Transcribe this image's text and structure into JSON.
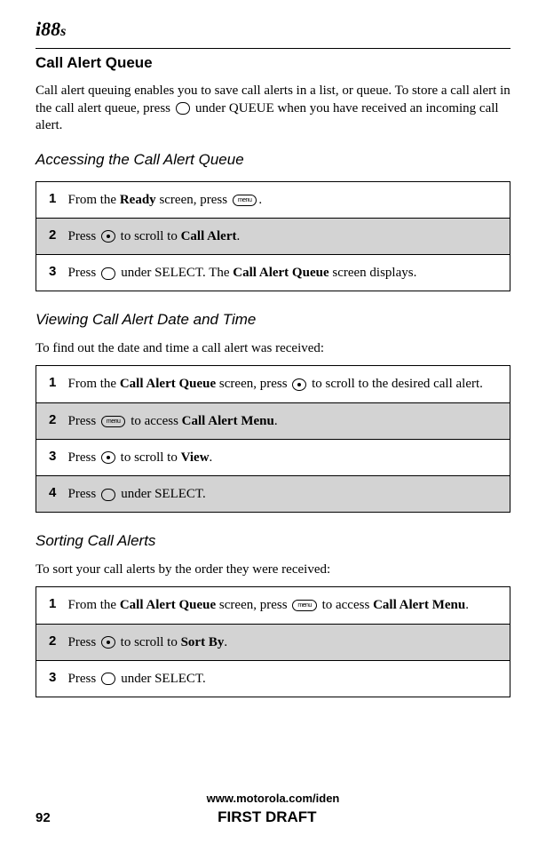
{
  "device_model": "i88s",
  "section_title": "Call Alert Queue",
  "intro_paragraph": "Call alert queuing enables you to save call alerts in a list, or queue. To store a call alert in the call alert queue, press ",
  "intro_paragraph_after_icon": " under QUEUE when you have received an incoming call alert.",
  "subsections": {
    "accessing": {
      "title": "Accessing the Call Alert Queue",
      "steps": [
        {
          "num": "1",
          "parts": [
            "From the ",
            "Ready",
            " screen, press ",
            "MENU_ICON",
            "."
          ]
        },
        {
          "num": "2",
          "parts": [
            "Press ",
            "NAV_ICON",
            " to scroll to ",
            "Call Alert",
            "."
          ]
        },
        {
          "num": "3",
          "parts": [
            "Press ",
            "BTN_ICON",
            " under SELECT. The ",
            "Call Alert Queue",
            " screen displays."
          ]
        }
      ]
    },
    "viewing": {
      "title": "Viewing Call Alert Date and Time",
      "intro": "To find out the date and time a call alert was received:",
      "steps": [
        {
          "num": "1",
          "parts": [
            "From the ",
            "Call Alert Queue",
            " screen, press ",
            "NAV_ICON",
            " to scroll to the desired call alert."
          ]
        },
        {
          "num": "2",
          "parts": [
            "Press ",
            "MENU_ICON",
            " to access ",
            "Call Alert Menu",
            "."
          ]
        },
        {
          "num": "3",
          "parts": [
            "Press ",
            "NAV_ICON",
            " to scroll to ",
            "View",
            "."
          ]
        },
        {
          "num": "4",
          "parts": [
            "Press ",
            "BTN_ICON",
            " under SELECT."
          ]
        }
      ]
    },
    "sorting": {
      "title": "Sorting Call Alerts",
      "intro": "To sort your call alerts by the order they were received:",
      "steps": [
        {
          "num": "1",
          "parts": [
            "From the ",
            "Call Alert Queue",
            " screen, press ",
            "MENU_ICON",
            " to access ",
            "Call Alert Menu",
            "."
          ]
        },
        {
          "num": "2",
          "parts": [
            "Press ",
            "NAV_ICON",
            " to scroll to ",
            "Sort By",
            "."
          ]
        },
        {
          "num": "3",
          "parts": [
            "Press ",
            "BTN_ICON",
            " under SELECT."
          ]
        }
      ]
    }
  },
  "footer": {
    "url": "www.motorola.com/iden",
    "page_num": "92",
    "draft": "FIRST DRAFT"
  },
  "icon_labels": {
    "menu": "menu",
    "button": " "
  },
  "bold_terms": [
    "Ready",
    "Call Alert",
    "Call Alert Queue",
    "Call Alert Menu",
    "View",
    "Sort By"
  ]
}
